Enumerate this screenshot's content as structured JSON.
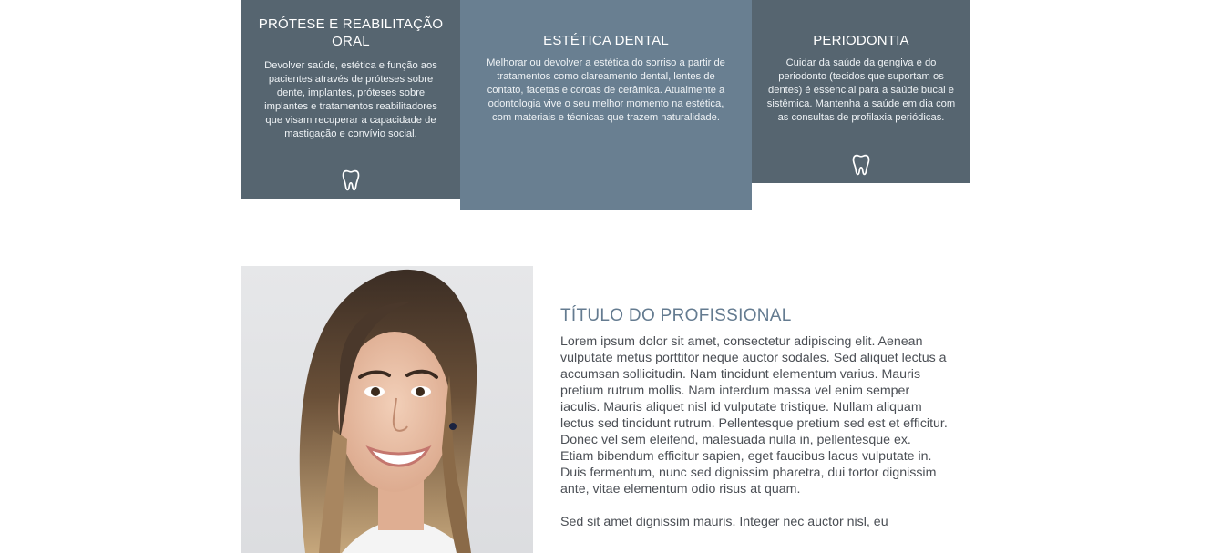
{
  "services": [
    {
      "title": "PRÓTESE E REABILITAÇÃO ORAL",
      "text": "Devolver saúde, estética e função aos pacientes através de próteses sobre dente, implantes, próteses sobre implantes e tratamentos reabilitadores que visam recuperar a capacidade de mastigação e convívio social.",
      "icon": "tooth-icon"
    },
    {
      "title": "ESTÉTICA DENTAL",
      "text": "Melhorar ou devolver a estética do sorriso a partir de tratamentos como clareamento dental, lentes de contato, facetas e coroas de cerâmica. Atualmente a odontologia vive o seu melhor momento na estética, com materiais e técnicas que trazem naturalidade.",
      "icon": ""
    },
    {
      "title": "PERIODONTIA",
      "text": "Cuidar da saúde da gengiva e do periodonto (tecidos que suportam os dentes) é essencial para a saúde bucal e sistêmica. Mantenha a saúde em dia com as consultas de profilaxia periódicas.",
      "icon": "tooth-icon"
    }
  ],
  "professional": {
    "title": "TÍTULO DO PROFISSIONAL",
    "paragraphs": [
      "Lorem ipsum dolor sit amet, consectetur adipiscing elit. Aenean vulputate metus porttitor neque auctor sodales. Sed aliquet lectus a accumsan sollicitudin. Nam tincidunt elementum varius. Mauris pretium rutrum mollis. Nam interdum massa vel enim semper iaculis. Mauris aliquet nisl id vulputate tristique. Nullam aliquam lectus sed tincidunt rutrum. Pellentesque pretium sed est et efficitur. Donec vel sem eleifend, malesuada nulla in, pellentesque ex. Etiam bibendum efficitur sapien, eget faucibus lacus vulputate in. Duis fermentum, nunc sed dignissim pharetra, dui tortor dignissim ante, vitae elementum odio risus at quam.",
      "Sed sit amet dignissim mauris. Integer nec auctor nisl, eu"
    ]
  },
  "colors": {
    "card_dark": "#566570",
    "card_light": "#697f91",
    "title_accent": "#647b90"
  }
}
